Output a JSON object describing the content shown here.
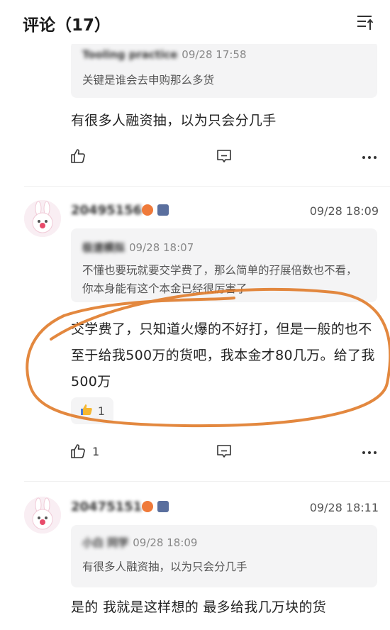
{
  "header": {
    "title": "评论（17）",
    "sort_icon": "sort-icon"
  },
  "comments": [
    {
      "quote": {
        "name": "Tooling practice",
        "time": "09/28 17:58",
        "text": "关键是谁会去申购那么多货"
      },
      "body": "有很多人融资抽，以为只会分几手",
      "like_count": ""
    },
    {
      "username": "20495156",
      "time": "09/28 18:09",
      "quote": {
        "name": "极速模拟",
        "time": "09/28 18:07",
        "text": "不懂也要玩就要交学费了，那么简单的孖展倍数也不看，你本身能有这个本金已经很厉害了"
      },
      "body": "交学费了，只知道火爆的不好打，但是一般的也不至于给我500万的货吧，我本金才80几万。给了我500万",
      "reaction_count": "1",
      "like_count": "1"
    },
    {
      "username": "20475151",
      "time": "09/28 18:11",
      "quote": {
        "name": "小白 同学",
        "time": "09/28 18:09",
        "text": "有很多人融资抽，以为只会分几手"
      },
      "body": "是的 我就是这样想的 最多给我几万块的货"
    }
  ],
  "colors": {
    "annotation": "#e07b2a",
    "quote_bg": "#f4f4f5"
  }
}
